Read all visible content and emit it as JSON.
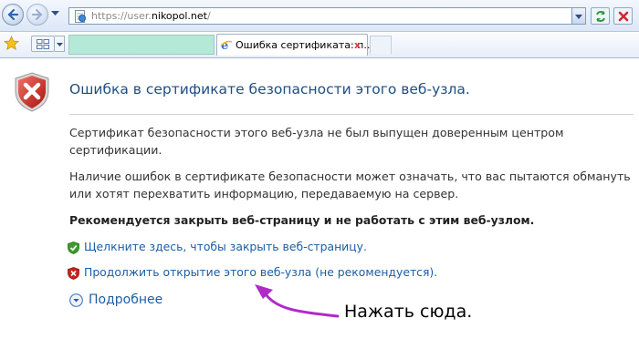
{
  "address_bar": {
    "url_prefix": "https://user.",
    "url_host": "nikopol.net",
    "url_suffix": "/"
  },
  "tabs": {
    "active_title": "Ошибка сертификата: п...",
    "close_glyph": "x"
  },
  "page": {
    "title": "Ошибка в сертификате безопасности этого веб-узла.",
    "paragraph_1": "Сертификат безопасности этого веб-узла не был выпущен доверенным центром сертификации.",
    "paragraph_2": "Наличие ошибок в сертификате безопасности может означать, что вас пытаются обмануть или хотят перехватить информацию, передаваемую на сервер.",
    "recommendation": "Рекомендуется закрыть веб-страницу и не работать с этим веб-узлом.",
    "link_close": "Щелкните здесь, чтобы закрыть веб-страницу.",
    "link_continue": "Продолжить открытие этого веб-узла (не рекомендуется).",
    "more_info": "Подробнее"
  },
  "annotation": {
    "text": "Нажать сюда."
  },
  "colors": {
    "title": "#1f4e85",
    "link": "#1a5ea6",
    "annotation_arrow": "#b02ac8",
    "shield_red": "#c8211d",
    "shield_green": "#3e9a2c"
  }
}
